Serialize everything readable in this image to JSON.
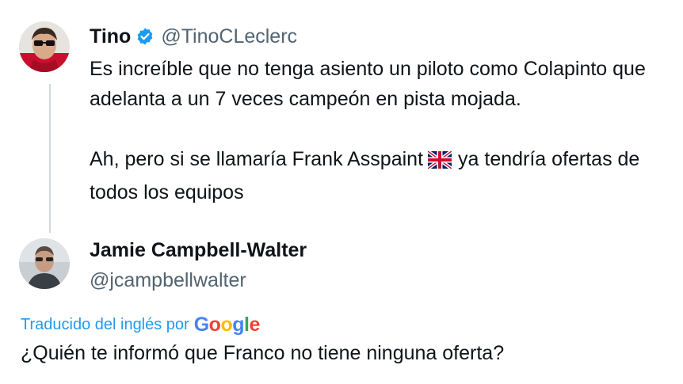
{
  "tweet": {
    "display_name": "Tino",
    "handle": "@TinoCLeclerc",
    "text_line1": "Es increíble que no tenga asiento un piloto como Colapinto que adelanta a un 7 veces campeón en pista mojada.",
    "text_line2_before_flag": "Ah, pero si se llamaría Frank Asspaint",
    "text_line2_after_flag": "ya tendría ofertas de todos los equipos",
    "flag_icon": "uk-flag-icon"
  },
  "reply": {
    "display_name": "Jamie Campbell-Walter",
    "handle": "@jcampbellwalter",
    "translated_label": "Traducido del inglés por",
    "translator": "Google",
    "text": "¿Quién te informó que Franco no tiene ninguna oferta?"
  },
  "colors": {
    "verified_blue": "#1d9bf0",
    "link_blue": "#1d9bf0",
    "secondary_text": "#536471"
  }
}
